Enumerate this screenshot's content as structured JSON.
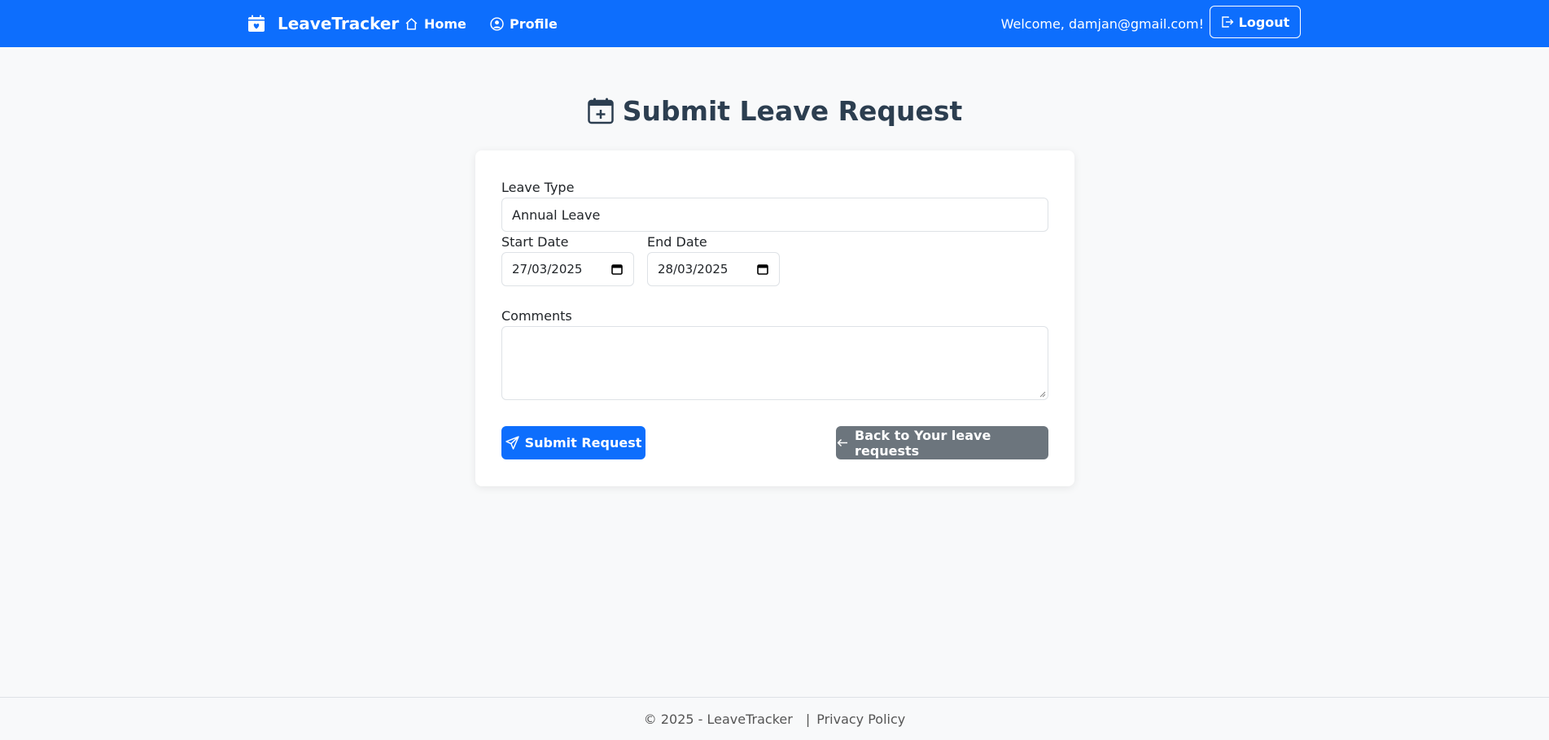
{
  "navbar": {
    "brand": "LeaveTracker",
    "links": [
      {
        "label": "Home",
        "icon": "house-icon"
      },
      {
        "label": "Profile",
        "icon": "person-circle-icon"
      }
    ],
    "welcome": "Welcome, damjan@gmail.com!",
    "logout_label": "Logout",
    "background": "#0d6efd"
  },
  "page": {
    "title": "Submit Leave Request",
    "title_icon": "calendar-plus-icon"
  },
  "form": {
    "leave_type_label": "Leave Type",
    "leave_type_value": "Annual Leave",
    "start_date_label": "Start Date",
    "start_date_value": "27/03/2025",
    "end_date_label": "End Date",
    "end_date_value": "28/03/2025",
    "comments_label": "Comments",
    "comments_value": "",
    "submit_label": "Submit Request",
    "back_label": "Back to Your leave requests"
  },
  "footer": {
    "copyright": "© 2025 - LeaveTracker",
    "separator": "|",
    "privacy_label": "Privacy Policy"
  },
  "colors": {
    "primary": "#0d6efd",
    "secondary": "#6c757d",
    "page_bg": "#f8f9fa",
    "title": "#2c3e50"
  }
}
